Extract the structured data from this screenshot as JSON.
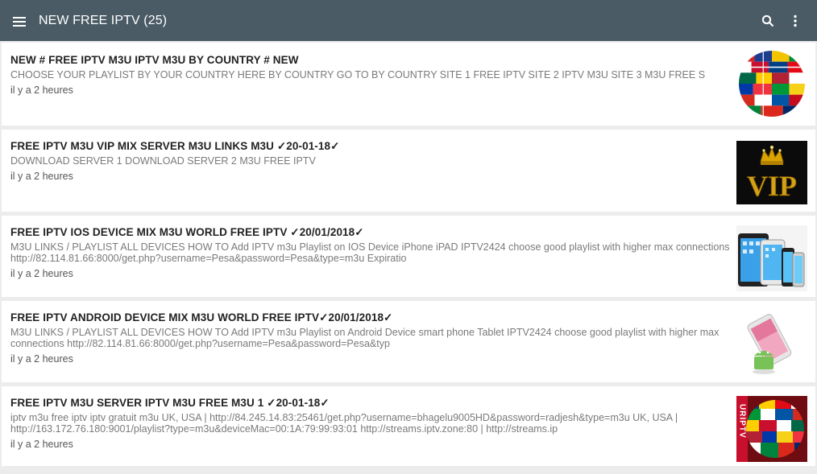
{
  "appbar": {
    "title": "NEW FREE IPTV (25)",
    "bg_color": "#4a5b66",
    "left_icon": "menu-icon",
    "right_icons": [
      "search-icon",
      "more-vert-icon"
    ]
  },
  "posts": [
    {
      "title": "NEW # FREE IPTV M3U  IPTV M3U BY COUNTRY # NEW",
      "description": "CHOOSE YOUR PLAYLIST BY YOUR COUNTRY HERE BY COUNTRY GO TO BY COUNTRY SITE 1 FREE IPTV SITE 2 IPTV M3U SITE 3 M3U FREE S",
      "time": "il y a 2 heures",
      "thumb": "flags-globe"
    },
    {
      "title": "FREE IPTV M3U VIP MIX SERVER M3U LINKS M3U ✓20-01-18✓",
      "description": "DOWNLOAD SERVER 1 DOWNLOAD SERVER 2 M3U FREE IPTV",
      "time": "il y a 2 heures",
      "thumb": "vip-crown",
      "thumb_text": "VIP"
    },
    {
      "title": "FREE IPTV IOS DEVICE MIX M3U WORLD FREE IPTV ✓20/01/2018✓",
      "description": "M3U LINKS / PLAYLIST  ALL DEVICES HOW TO Add IPTV m3u Playlist on IOS Device  iPhone  iPAD IPTV2424 choose good playlist with higher max connections http://82.114.81.66:8000/get.php?username=Pesa&password=Pesa&type=m3u Expiratio",
      "time": "il y a 2 heures",
      "thumb": "ios-devices"
    },
    {
      "title": "FREE IPTV ANDROID DEVICE MIX M3U WORLD FREE IPTV✓20/01/2018✓",
      "description": "M3U LINKS / PLAYLIST  ALL DEVICES HOW TO Add IPTV m3u Playlist on Android Device smart phone  Tablet IPTV2424 choose good playlist with higher max connections http://82.114.81.66:8000/get.php?username=Pesa&password=Pesa&typ",
      "time": "il y a 2 heures",
      "thumb": "android-phone"
    },
    {
      "title": "FREE IPTV M3U SERVER IPTV M3U FREE M3U 1 ✓20-01-18✓",
      "description": "iptv m3u free iptv iptv gratuit m3u UK, USA |  http://84.245.14.83:25461/get.php?username=bhagelu9005HD&password=radjesh&type=m3u UK, USA |  http://163.172.76.180:9001/playlist?type=m3u&deviceMac=00:1A:79:99:93:01 http://streams.iptv.zone:80 |  http://streams.ip",
      "time": "il y a 2 heures",
      "thumb": "uriptv-globe",
      "thumb_text": "URIPTV"
    }
  ]
}
